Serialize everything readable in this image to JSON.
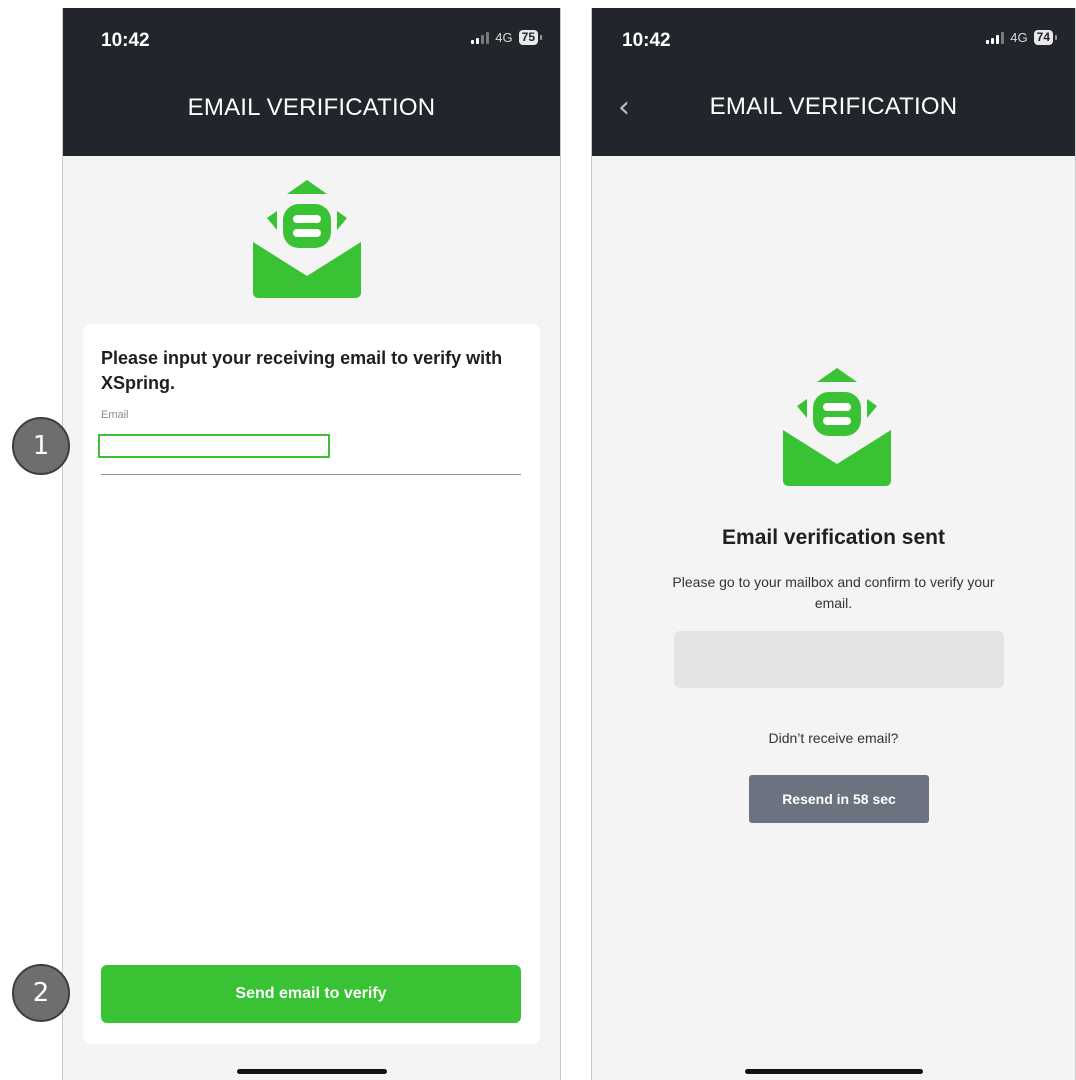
{
  "left_screen": {
    "status": {
      "time": "10:42",
      "network": "4G",
      "battery": "75"
    },
    "header": {
      "title": "EMAIL VERIFICATION"
    },
    "icon": "open-envelope-icon",
    "card": {
      "prompt": "Please input your receiving email to verify with XSpring.",
      "email_label": "Email",
      "email_value": ""
    },
    "button": {
      "label": "Send email to verify"
    }
  },
  "right_screen": {
    "status": {
      "time": "10:42",
      "network": "4G",
      "battery": "74"
    },
    "header": {
      "title": "EMAIL VERIFICATION",
      "back_icon": "chevron-left-icon"
    },
    "icon": "open-envelope-icon",
    "sent": {
      "title": "Email verification sent",
      "text": "Please go to your mailbox and confirm to verify your email.",
      "email_display": ""
    },
    "resend": {
      "question": "Didn’t receive email?",
      "button_label": "Resend in 58 sec"
    }
  },
  "annotations": {
    "step1": "1",
    "step2": "2"
  },
  "colors": {
    "header_bg": "#22252b",
    "accent_green": "#38c234",
    "page_bg": "#f4f4f4",
    "resend_bg": "#6b7280",
    "badge_bg": "#6e6e6e"
  }
}
